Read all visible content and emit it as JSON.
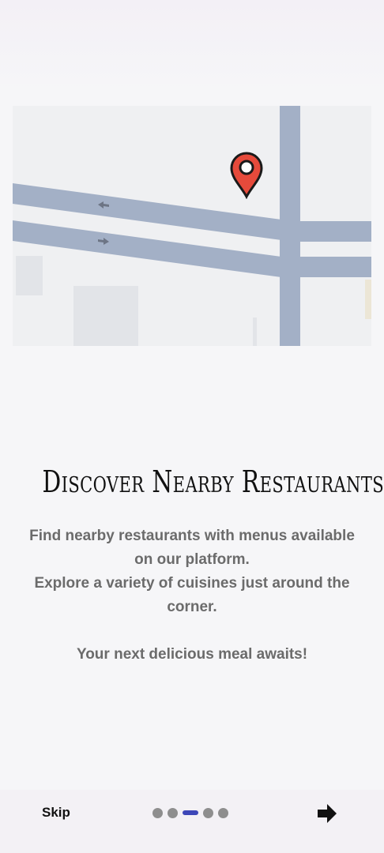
{
  "onboarding": {
    "title": "Discover Nearby Restaurants",
    "description_lines": [
      "Find nearby restaurants with menus available on our platform.",
      "Explore a variety of cuisines just around the corner."
    ],
    "tagline": "Your next delicious meal awaits!"
  },
  "footer": {
    "skip_label": "Skip",
    "page_count": 5,
    "current_page": 3,
    "next_icon": "arrow-right-icon"
  },
  "map": {
    "pin_icon": "location-pin-icon",
    "road_color": "#a3b0c6",
    "pin_color": "#e64a3b"
  }
}
